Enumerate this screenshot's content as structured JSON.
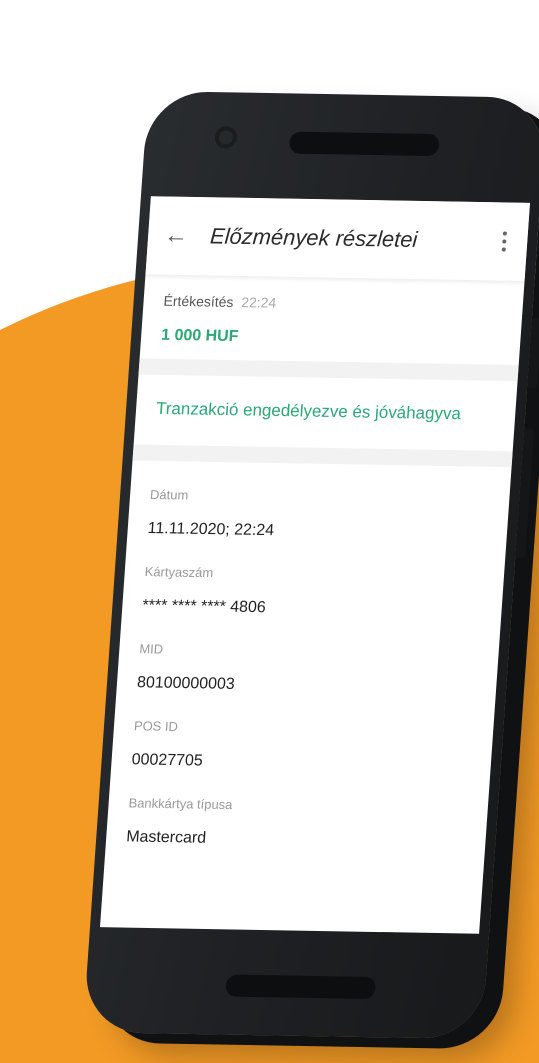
{
  "colors": {
    "background_orange": "#F39A25",
    "accent_green": "#2AA876",
    "phone_body": "#1F2124"
  },
  "app_bar": {
    "title": "Előzmények részletei",
    "back_icon": "arrow-left-icon",
    "menu_icon": "more-vertical-icon"
  },
  "transaction": {
    "type_label": "Értékesítés",
    "time": "22:24",
    "amount": "1 000 HUF",
    "status": "Tranzakció engedélyezve és jóváhagyva"
  },
  "details": [
    {
      "label": "Dátum",
      "value": "11.11.2020; 22:24"
    },
    {
      "label": "Kártyaszám",
      "value": "**** **** **** 4806"
    },
    {
      "label": "MID",
      "value": "80100000003"
    },
    {
      "label": "POS ID",
      "value": "00027705"
    },
    {
      "label": "Bankkártya típusa",
      "value": "Mastercard"
    }
  ]
}
